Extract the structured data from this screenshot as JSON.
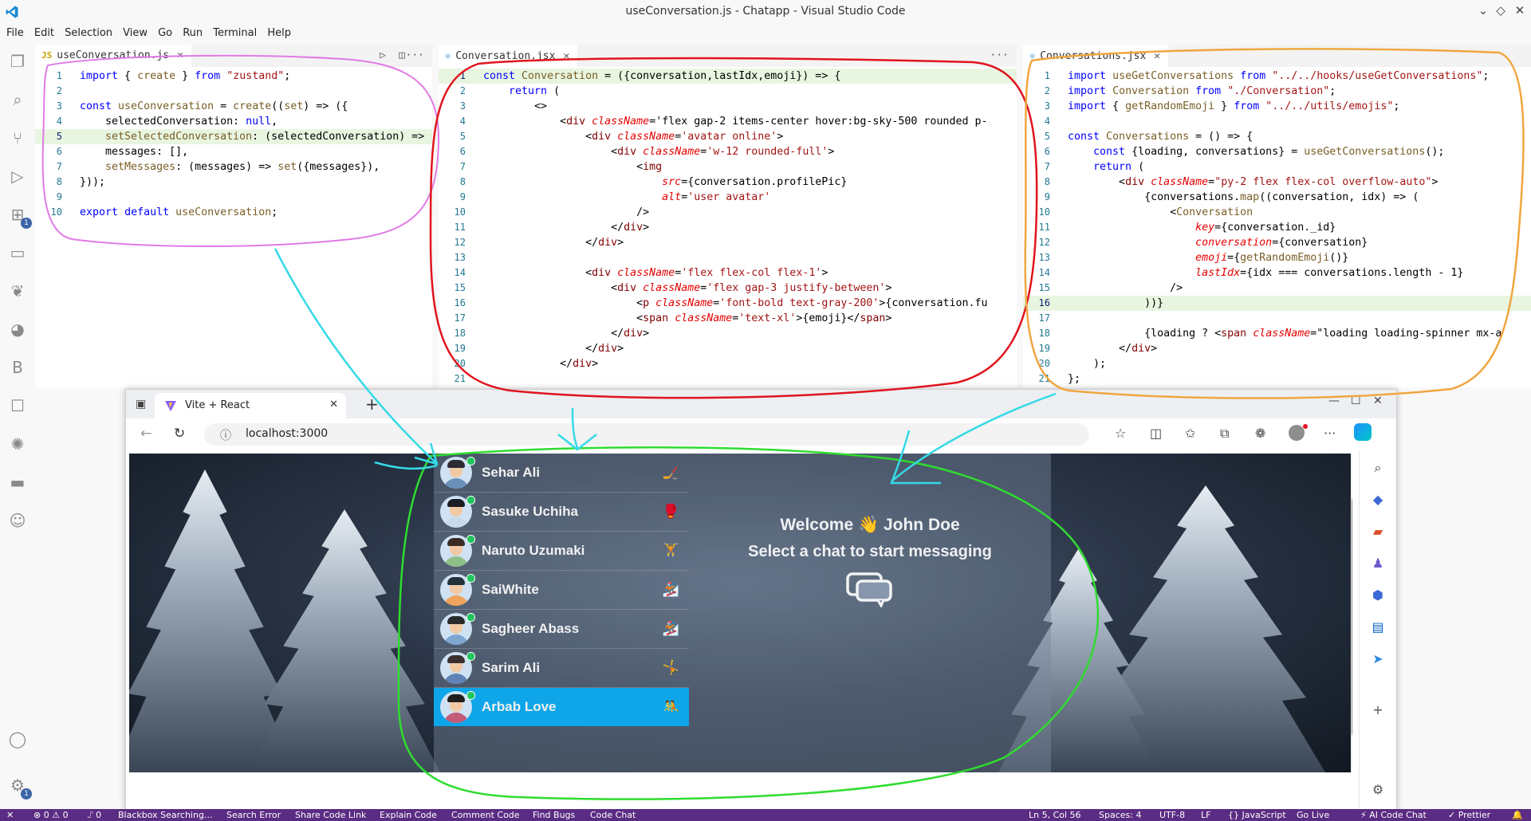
{
  "window": {
    "title": "useConversation.js - Chatapp - Visual Studio Code",
    "menu": [
      "File",
      "Edit",
      "Selection",
      "View",
      "Go",
      "Run",
      "Terminal",
      "Help"
    ]
  },
  "activity_bar": {
    "icons": [
      "explorer-icon",
      "search-icon",
      "source-control-icon",
      "run-debug-icon",
      "extensions-icon",
      "folder-icon",
      "leaf-icon",
      "git-graph-icon",
      "b-icon",
      "chat-bubble-icon",
      "bug-icon",
      "env-icon",
      "copilot-icon",
      "account-icon",
      "settings-gear-icon"
    ],
    "extensions_badge": "1",
    "settings_badge": "1"
  },
  "editors": {
    "left": {
      "tab": "useConversation.js",
      "tab_icon": "JS",
      "lines": [
        {
          "n": "1",
          "code": "import { create } from \"zustand\";"
        },
        {
          "n": "2",
          "code": ""
        },
        {
          "n": "3",
          "code": "const useConversation = create((set) => ({"
        },
        {
          "n": "4",
          "code": "    selectedConversation: null,"
        },
        {
          "n": "5",
          "code": "    setSelectedConversation: (selectedConversation) => set({ selectedConversation }),"
        },
        {
          "n": "6",
          "code": "    messages: [],"
        },
        {
          "n": "7",
          "code": "    setMessages: (messages) => set({messages}),"
        },
        {
          "n": "8",
          "code": "}));"
        },
        {
          "n": "9",
          "code": ""
        },
        {
          "n": "10",
          "code": "export default useConversation;"
        }
      ]
    },
    "middle": {
      "tab": "Conversation.jsx",
      "lines": [
        {
          "n": "1",
          "code": "const Conversation = ({conversation,lastIdx,emoji}) => {"
        },
        {
          "n": "2",
          "code": "    return ("
        },
        {
          "n": "3",
          "code": "        <>"
        },
        {
          "n": "4",
          "code": "            <div className='flex gap-2 items-center hover:bg-sky-500 rounded p-"
        },
        {
          "n": "5",
          "code": "                <div className='avatar online'>"
        },
        {
          "n": "6",
          "code": "                    <div className='w-12 rounded-full'>"
        },
        {
          "n": "7",
          "code": "                        <img"
        },
        {
          "n": "8",
          "code": "                            src={conversation.profilePic}"
        },
        {
          "n": "9",
          "code": "                            alt='user avatar'"
        },
        {
          "n": "10",
          "code": "                        />"
        },
        {
          "n": "11",
          "code": "                    </div>"
        },
        {
          "n": "12",
          "code": "                </div>"
        },
        {
          "n": "13",
          "code": ""
        },
        {
          "n": "14",
          "code": "                <div className='flex flex-col flex-1'>"
        },
        {
          "n": "15",
          "code": "                    <div className='flex gap-3 justify-between'>"
        },
        {
          "n": "16",
          "code": "                        <p className='font-bold text-gray-200'>{conversation.fu"
        },
        {
          "n": "17",
          "code": "                        <span className='text-xl'>{emoji}</span>"
        },
        {
          "n": "18",
          "code": "                    </div>"
        },
        {
          "n": "19",
          "code": "                </div>"
        },
        {
          "n": "20",
          "code": "            </div>"
        },
        {
          "n": "21",
          "code": ""
        }
      ]
    },
    "right": {
      "tab": "Conversations.jsx",
      "lines": [
        {
          "n": "1",
          "code": "import useGetConversations from \"../../hooks/useGetConversations\";"
        },
        {
          "n": "2",
          "code": "import Conversation from \"./Conversation\";"
        },
        {
          "n": "3",
          "code": "import { getRandomEmoji } from \"../../utils/emojis\";"
        },
        {
          "n": "4",
          "code": ""
        },
        {
          "n": "5",
          "code": "const Conversations = () => {"
        },
        {
          "n": "6",
          "code": "    const {loading, conversations} = useGetConversations();"
        },
        {
          "n": "7",
          "code": "    return ("
        },
        {
          "n": "8",
          "code": "        <div className=\"py-2 flex flex-col overflow-auto\">"
        },
        {
          "n": "9",
          "code": "            {conversations.map((conversation, idx) => ("
        },
        {
          "n": "10",
          "code": "                <Conversation"
        },
        {
          "n": "11",
          "code": "                    key={conversation._id}"
        },
        {
          "n": "12",
          "code": "                    conversation={conversation}"
        },
        {
          "n": "13",
          "code": "                    emoji={getRandomEmoji()}"
        },
        {
          "n": "14",
          "code": "                    lastIdx={idx === conversations.length - 1}"
        },
        {
          "n": "15",
          "code": "                />"
        },
        {
          "n": "16",
          "code": "            ))}"
        },
        {
          "n": "17",
          "code": ""
        },
        {
          "n": "18",
          "code": "            {loading ? <span className=\"loading loading-spinner mx-a"
        },
        {
          "n": "19",
          "code": "        </div>"
        },
        {
          "n": "20",
          "code": "    );"
        },
        {
          "n": "21",
          "code": "};"
        }
      ]
    }
  },
  "browser": {
    "tab_title": "Vite + React",
    "url": "localhost:3000",
    "conversations": [
      {
        "name": "Sehar Ali",
        "emoji": "🏒"
      },
      {
        "name": "Sasuke Uchiha",
        "emoji": "🥊"
      },
      {
        "name": "Naruto Uzumaki",
        "emoji": "🏋"
      },
      {
        "name": "SaiWhite",
        "emoji": "🏂"
      },
      {
        "name": "Sagheer Abass",
        "emoji": "🏂"
      },
      {
        "name": "Sarim Ali",
        "emoji": "🤸"
      },
      {
        "name": "Arbab Love",
        "emoji": "🤼"
      }
    ],
    "selected_conversation": "Arbab Love",
    "welcome_line1": "Welcome 👋 John Doe",
    "welcome_line2": "Select a chat to start messaging"
  },
  "status_bar": {
    "left": [
      "⊗ 0 ⚠ 0",
      "⑀ 0",
      "Blackbox Searching...",
      "Search Error",
      "Share Code Link",
      "Explain Code",
      "Comment Code",
      "Find Bugs",
      "Code Chat"
    ],
    "right": [
      "Ln 5, Col 56",
      "Spaces: 4",
      "UTF-8",
      "LF",
      "{} JavaScript",
      "Go Live",
      "⚡ AI Code Chat",
      "✓ Prettier"
    ]
  },
  "colors": {
    "status_bar": "#5b2c83",
    "selected_conversation": "#0ea5e9",
    "annot_pink": "#e07ae6",
    "annot_red": "#e0141e",
    "annot_orange": "#f0a640",
    "annot_green": "#2fdc2f",
    "annot_cyan": "#36d9e6"
  }
}
